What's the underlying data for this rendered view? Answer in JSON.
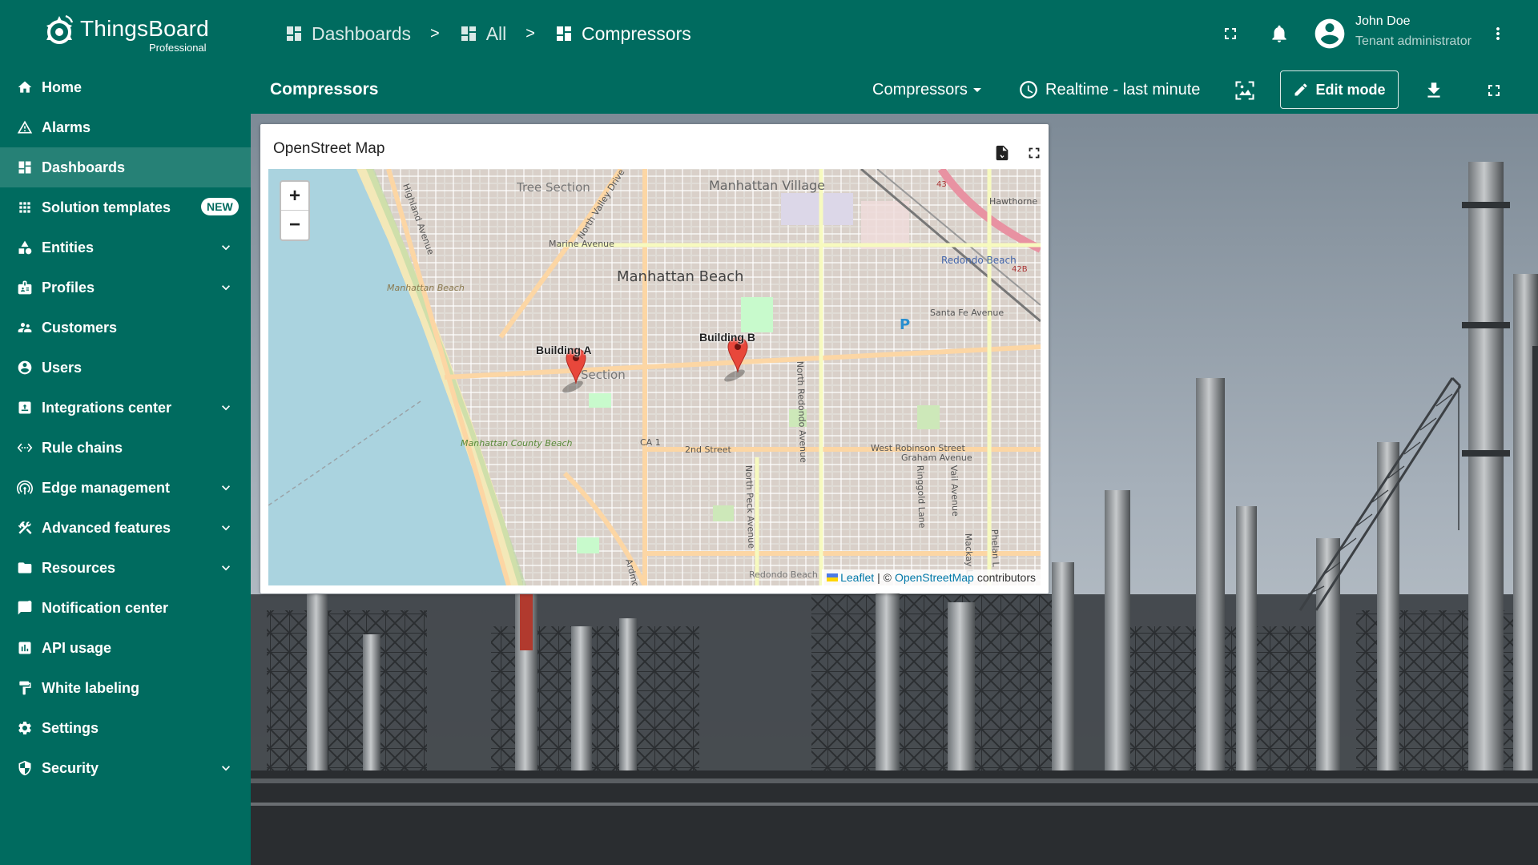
{
  "app": {
    "logo_name": "ThingsBoard",
    "logo_sub": "Professional"
  },
  "breadcrumb": [
    {
      "label": "Dashboards"
    },
    {
      "label": "All"
    },
    {
      "label": "Compressors"
    }
  ],
  "breadcrumb_separator": ">",
  "user": {
    "name": "John Doe",
    "role": "Tenant administrator"
  },
  "sidebar": {
    "items": [
      {
        "label": "Home",
        "icon": "home-icon",
        "expandable": false
      },
      {
        "label": "Alarms",
        "icon": "warning-icon",
        "expandable": false
      },
      {
        "label": "Dashboards",
        "icon": "dashboard-icon",
        "expandable": false,
        "selected": true
      },
      {
        "label": "Solution templates",
        "icon": "apps-icon",
        "expandable": false,
        "badge": "NEW"
      },
      {
        "label": "Entities",
        "icon": "category-icon",
        "expandable": true
      },
      {
        "label": "Profiles",
        "icon": "badge-icon",
        "expandable": true
      },
      {
        "label": "Customers",
        "icon": "supervisor-icon",
        "expandable": false
      },
      {
        "label": "Users",
        "icon": "account-circle-icon",
        "expandable": false
      },
      {
        "label": "Integrations center",
        "icon": "integration-icon",
        "expandable": true
      },
      {
        "label": "Rule chains",
        "icon": "settings-ethernet-icon",
        "expandable": false
      },
      {
        "label": "Edge management",
        "icon": "router-icon",
        "expandable": true
      },
      {
        "label": "Advanced features",
        "icon": "construction-icon",
        "expandable": true
      },
      {
        "label": "Resources",
        "icon": "folder-icon",
        "expandable": true
      },
      {
        "label": "Notification center",
        "icon": "notification-icon",
        "expandable": false
      },
      {
        "label": "API usage",
        "icon": "insert-chart-icon",
        "expandable": false
      },
      {
        "label": "White labeling",
        "icon": "format-paint-icon",
        "expandable": false
      },
      {
        "label": "Settings",
        "icon": "settings-icon",
        "expandable": false
      },
      {
        "label": "Security",
        "icon": "security-icon",
        "expandable": true
      }
    ]
  },
  "dashboard": {
    "title": "Compressors",
    "state_select": "Compressors",
    "timewindow": "Realtime - last minute",
    "edit_mode_label": "Edit mode"
  },
  "widget": {
    "title": "OpenStreet Map",
    "zoom_in": "+",
    "zoom_out": "−",
    "attribution": {
      "leaflet": "Leaflet",
      "separator": "| ©",
      "osm": "OpenStreetMap",
      "contributors": "contributors"
    },
    "markers": [
      {
        "label": "Building A"
      },
      {
        "label": "Building B"
      }
    ],
    "map_labels": {
      "tree_section": "Tree Section",
      "manhattan_village": "Manhattan Village",
      "manhattan_beach": "Manhattan Beach",
      "marine_avenue": "Marine Avenue",
      "north_valley_drive": "North Valley Drive",
      "highland_avenue": "Highland Avenue",
      "redondo_beach": "Redondo Beach",
      "santa_fe_avenue": "Santa Fe Avenue",
      "hawthorne": "Hawthorne",
      "beach_label": "Manhattan Beach",
      "section": "Section",
      "ca1": "CA 1",
      "second_street": "2nd Street",
      "west_robinson": "West Robinson Street",
      "graham_avenue": "Graham Avenue",
      "north_redondo_avenue": "North Redondo Avenue",
      "north_peck_avenue": "North Peck Avenue",
      "ringgold_lane": "Ringgold Lane",
      "vail_avenue": "Vail Avenue",
      "mackay": "Mackay L",
      "phelan": "Phelan L",
      "county_beach": "Manhattan County Beach",
      "redondo_beach_bottom": "Redondo Beach",
      "ardmore": "Ardmo",
      "rt43": "43",
      "rt42b": "42B",
      "parking": "P"
    }
  }
}
